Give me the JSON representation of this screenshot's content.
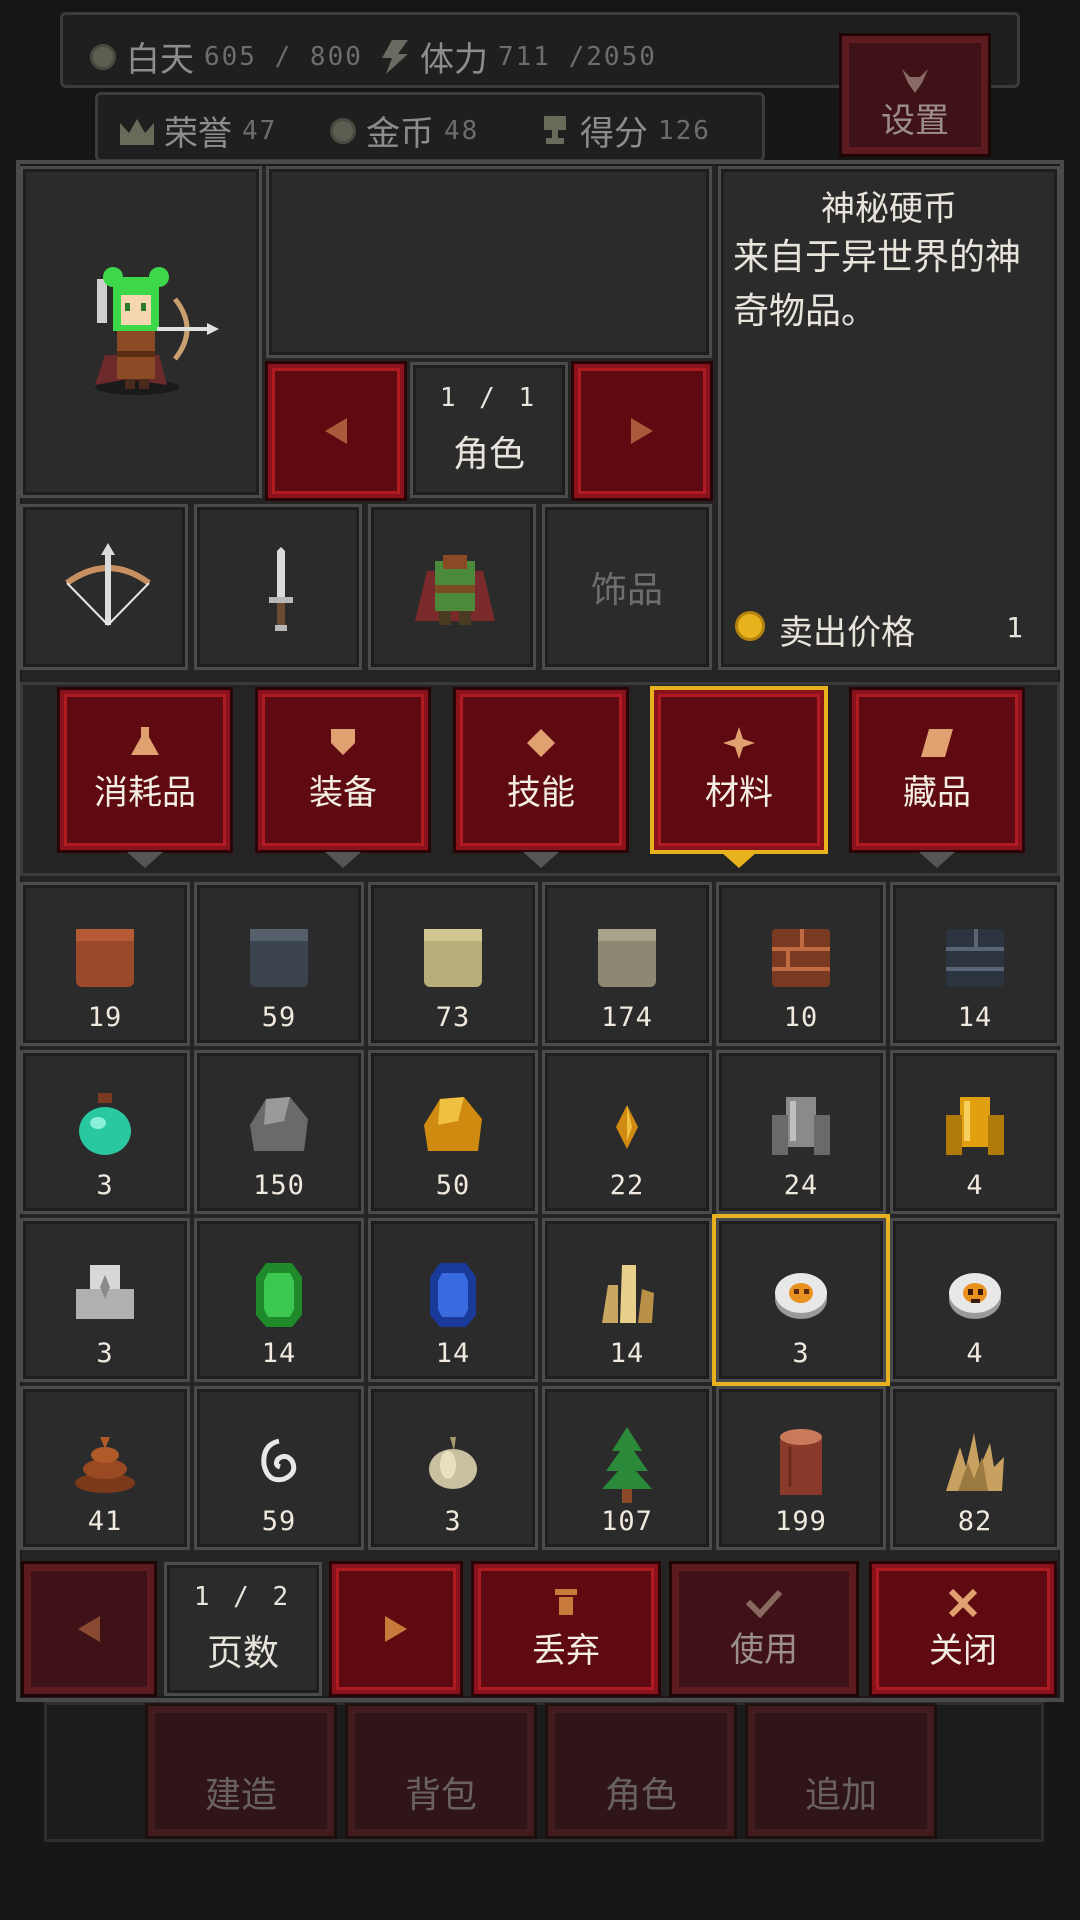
{
  "status": {
    "day_label": "白天",
    "day_value": "605 / 800",
    "stamina_label": "体力",
    "stamina_value": "711 /2050",
    "honor_label": "荣誉",
    "honor_value": "47",
    "gold_label": "金币",
    "gold_value": "48",
    "score_label": "得分",
    "score_value": "126",
    "settings_label": "设置"
  },
  "character": {
    "page": "1  /  1",
    "label": "角色",
    "accessory_label": "饰品"
  },
  "detail": {
    "title": "神秘硬币",
    "description": "来自于异世界的神奇物品。",
    "price_label": "卖出价格",
    "price_value": "1"
  },
  "tabs": [
    {
      "label": "消耗品",
      "icon": "potion-icon"
    },
    {
      "label": "装备",
      "icon": "shield-icon"
    },
    {
      "label": "技能",
      "icon": "diamond-icon"
    },
    {
      "label": "材料",
      "icon": "gear-icon",
      "selected": true
    },
    {
      "label": "藏品",
      "icon": "scroll-icon"
    }
  ],
  "items": [
    {
      "icon": "brown-block-icon",
      "count": "19"
    },
    {
      "icon": "slate-block-icon",
      "count": "59"
    },
    {
      "icon": "sand-block-icon",
      "count": "73"
    },
    {
      "icon": "stone-block-icon",
      "count": "174"
    },
    {
      "icon": "brick-icon",
      "count": "10"
    },
    {
      "icon": "stone-brick-icon",
      "count": "14"
    },
    {
      "icon": "teal-potion-icon",
      "count": "3"
    },
    {
      "icon": "iron-ore-icon",
      "count": "150"
    },
    {
      "icon": "gold-ore-icon",
      "count": "50"
    },
    {
      "icon": "amber-shard-icon",
      "count": "22"
    },
    {
      "icon": "iron-ingot-icon",
      "count": "24"
    },
    {
      "icon": "gold-ingot-icon",
      "count": "4"
    },
    {
      "icon": "silver-ingot-icon",
      "count": "3"
    },
    {
      "icon": "emerald-icon",
      "count": "14"
    },
    {
      "icon": "sapphire-icon",
      "count": "14"
    },
    {
      "icon": "crystal-cluster-icon",
      "count": "14"
    },
    {
      "icon": "mystery-coin-icon",
      "count": "3",
      "selected": true
    },
    {
      "icon": "skull-coin-icon",
      "count": "4"
    },
    {
      "icon": "dung-icon",
      "count": "41"
    },
    {
      "icon": "spiral-icon",
      "count": "59"
    },
    {
      "icon": "garlic-icon",
      "count": "3"
    },
    {
      "icon": "tree-icon",
      "count": "107"
    },
    {
      "icon": "log-icon",
      "count": "199"
    },
    {
      "icon": "hay-icon",
      "count": "82"
    }
  ],
  "footer": {
    "page": "1  /  2",
    "page_label": "页数",
    "discard_label": "丢弃",
    "use_label": "使用",
    "close_label": "关闭"
  },
  "bottom_nav": [
    "建造",
    "背包",
    "角色",
    "追加"
  ],
  "colors": {
    "accent_red": "#5e0a10",
    "highlight_gold": "#e8b21c",
    "panel": "#242424"
  }
}
